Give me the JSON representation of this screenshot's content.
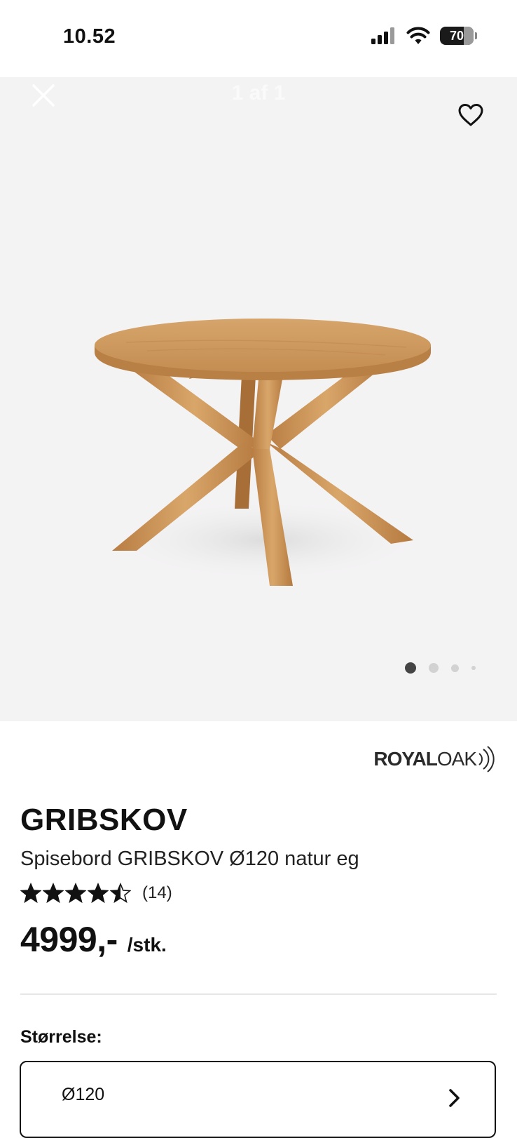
{
  "status_bar": {
    "time": "10.52",
    "battery": "70"
  },
  "gallery": {
    "counter": "1 af 1",
    "image_count": 4,
    "active_index": 0
  },
  "product": {
    "brand_royal": "ROYAL",
    "brand_oak": "OAK",
    "name": "GRIBSKOV",
    "description": "Spisebord GRIBSKOV Ø120 natur eg",
    "rating": 4.5,
    "review_count": "(14)",
    "price": "4999,-",
    "unit": "/stk."
  },
  "size": {
    "label": "Størrelse:",
    "value": "Ø120"
  },
  "icons": {
    "close": "close-icon",
    "favorite": "heart-icon",
    "chevron": "chevron-right-icon"
  },
  "colors": {
    "gallery_bg": "#f4f3f4",
    "wood": "#c8935a"
  }
}
